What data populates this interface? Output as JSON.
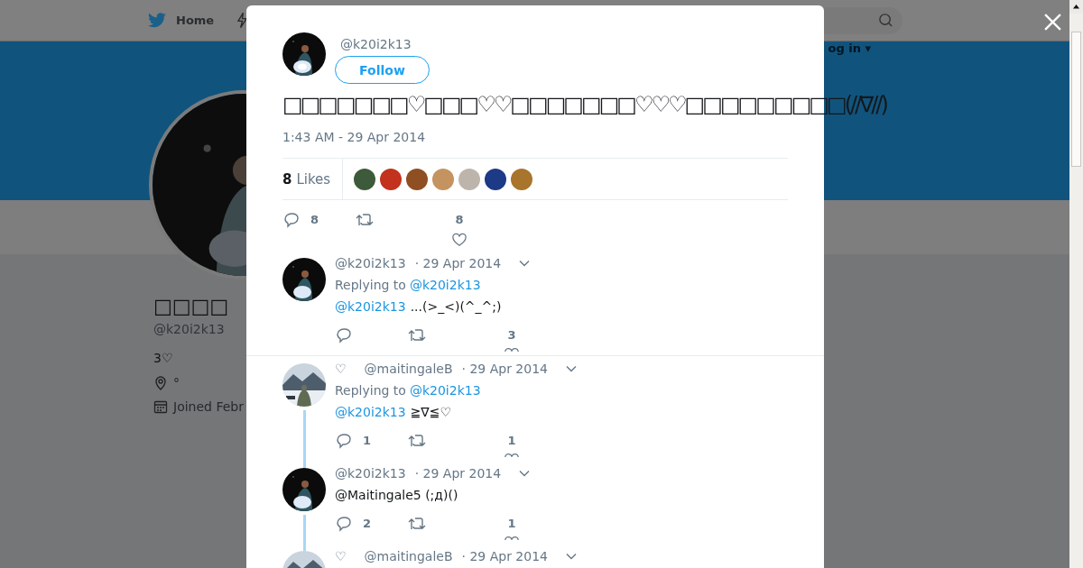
{
  "background_page": {
    "nav": {
      "home_label": "Home",
      "login_label": "og in ▾"
    },
    "profile": {
      "name": "□□□□",
      "handle": "@k20i2k13",
      "bio": "3♡",
      "location": "°",
      "joined": "Joined Febr"
    }
  },
  "modal": {
    "tweet": {
      "handle": "@k20i2k13",
      "follow_label": "Follow",
      "text": "□□□□□□□♡□□□♡♡□□□□□□□♡♡♡□□□□□□□□□(//∇//)",
      "timestamp": "1:43 AM - 29 Apr 2014",
      "likes_count": "8",
      "likes_label": "Likes",
      "likers": [
        {
          "color": "#3d5a3a"
        },
        {
          "color": "#c2321c"
        },
        {
          "color": "#8f4f22"
        },
        {
          "color": "#c4935f"
        },
        {
          "color": "#bdb5ac"
        },
        {
          "color": "#1c3a86"
        },
        {
          "color": "#a9742c"
        }
      ],
      "reply_count": "8",
      "like_count": "8"
    },
    "replies": [
      {
        "handle": "@k20i2k13",
        "date": "· 29 Apr 2014",
        "replying_label": "Replying to",
        "replying_to": "@k20i2k13",
        "mention": "@k20i2k13",
        "text": "...(>_<)(^_^;)",
        "like_count": "3",
        "thread_continues": false
      },
      {
        "name": "♡",
        "handle": "@maitingaleB",
        "date": "· 29 Apr 2014",
        "replying_label": "Replying to",
        "replying_to": "@k20i2k13",
        "mention": "@k20i2k13",
        "text": "≧∇≦♡",
        "reply_count": "1",
        "like_count": "1",
        "thread_continues": true
      },
      {
        "handle": "@k20i2k13",
        "date": "· 29 Apr 2014",
        "text": "@Maitingale5 (;д)()",
        "reply_count": "2",
        "like_count": "1",
        "thread_continues": true
      },
      {
        "name": "♡",
        "handle": "@maitingaleB",
        "date": "· 29 Apr 2014",
        "thread_continues": false
      }
    ]
  }
}
